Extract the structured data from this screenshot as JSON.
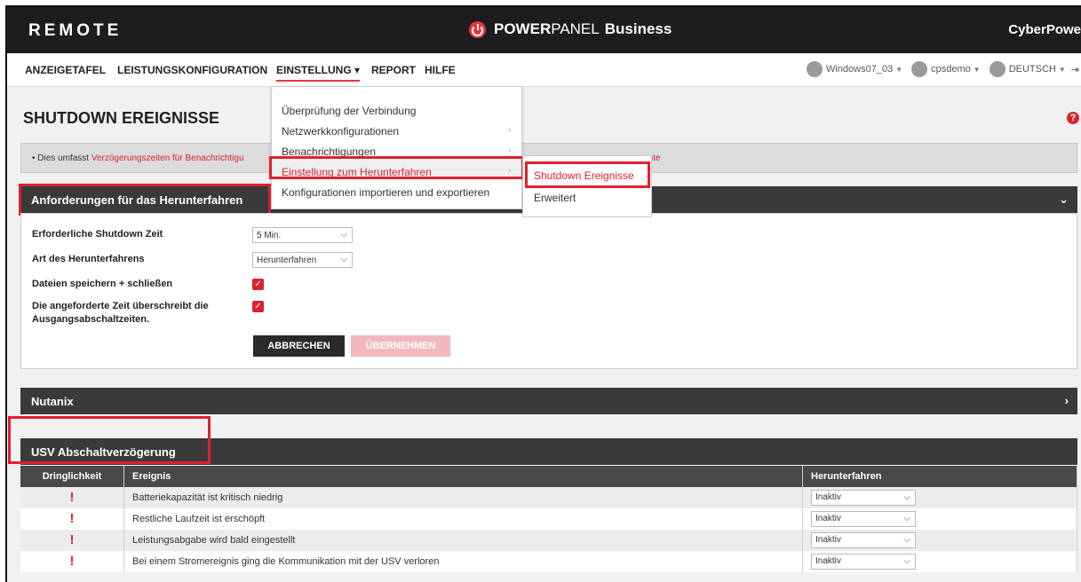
{
  "header": {
    "brand": "REMOTE",
    "logo_part1": "POWER",
    "logo_part2": "PANEL",
    "logo_part3": "Business",
    "vendor": "CyberPowe"
  },
  "nav": {
    "items": [
      "ANZEIGETAFEL",
      "LEISTUNGSKONFIGURATION",
      "EINSTELLUNG",
      "REPORT",
      "HILFE"
    ],
    "active_caret": "▾",
    "host": "Windows07_03",
    "user": "cpsdemo",
    "language": "DEUTSCH"
  },
  "page": {
    "title": "SHUTDOWN EREIGNISSE",
    "info_prefix": "•  Dies umfasst ",
    "info_link": "Verzögerungszeiten für Benachrichtigu",
    "info_suffix": "nte"
  },
  "menu": {
    "items": [
      {
        "label": "Überprüfung der Verbindung",
        "arrow": ""
      },
      {
        "label": "Netzwerkkonfigurationen",
        "arrow": "›"
      },
      {
        "label": "Benachrichtigungen",
        "arrow": "›"
      },
      {
        "label": "Einstellung zum Herunterfahren",
        "arrow": "›"
      },
      {
        "label": "Konfigurationen importieren und exportieren",
        "arrow": ""
      }
    ],
    "submenu": [
      "Shutdown Ereignisse",
      "Erweitert"
    ]
  },
  "shutdown_section": {
    "title": "Anforderungen für das Herunterfahren",
    "chevron": "⌄",
    "rows": {
      "time_label": "Erforderliche Shutdown Zeit",
      "time_value": "5 Min.",
      "type_label": "Art des Herunterfahrens",
      "type_value": "Herunterfahren",
      "save_label": "Dateien speichern + schließen",
      "override_label_1": "Die angeforderte Zeit überschreibt die",
      "override_label_2": "Ausgangsabschaltzeiten."
    },
    "check_mark": "✓",
    "cancel_label": "ABBRECHEN",
    "apply_label": "ÜBERNEHMEN"
  },
  "nutanix": {
    "title": "Nutanix",
    "chevron": "›"
  },
  "usv": {
    "title": "USV Abschaltverzögerung",
    "columns": [
      "Dringlichkeit",
      "Ereignis",
      "Herunterfahren"
    ],
    "rows": [
      {
        "urgency": "!",
        "event": "Batteriekapazität ist kritisch niedrig",
        "shutdown": "Inaktiv"
      },
      {
        "urgency": "!",
        "event": "Restliche Laufzeit ist erschöpft",
        "shutdown": "Inaktiv"
      },
      {
        "urgency": "!",
        "event": "Leistungsabgabe wird bald eingestellt",
        "shutdown": "Inaktiv"
      },
      {
        "urgency": "!",
        "event": "Bei einem Stromereignis ging die Kommunikation mit der USV verloren",
        "shutdown": "Inaktiv"
      }
    ]
  },
  "colors": {
    "accent": "#d9232e",
    "dark": "#1d1d1d",
    "section": "#3a3a3a"
  },
  "icons": {
    "help": "?",
    "dropdown": "⌵"
  }
}
